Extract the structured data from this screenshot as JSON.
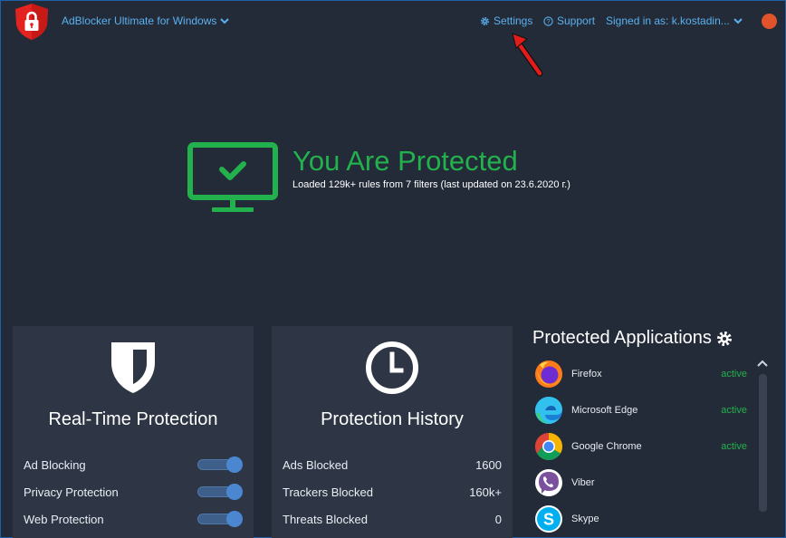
{
  "header": {
    "app_title": "AdBlocker Ultimate for Windows",
    "settings": "Settings",
    "support": "Support",
    "signed_in": "Signed in as: k.kostadin..."
  },
  "hero": {
    "title": "You Are Protected",
    "subtitle": "Loaded 129k+ rules from 7 filters (last updated on 23.6.2020 г.)"
  },
  "realtime": {
    "title": "Real-Time Protection",
    "items": [
      {
        "label": "Ad Blocking",
        "enabled": true
      },
      {
        "label": "Privacy Protection",
        "enabled": true
      },
      {
        "label": "Web Protection",
        "enabled": true
      }
    ]
  },
  "history": {
    "title": "Protection History",
    "items": [
      {
        "label": "Ads Blocked",
        "value": "1600"
      },
      {
        "label": "Trackers Blocked",
        "value": "160k+"
      },
      {
        "label": "Threats Blocked",
        "value": "0"
      }
    ]
  },
  "apps": {
    "title": "Protected Applications",
    "items": [
      {
        "name": "Firefox",
        "status": "active",
        "icon": "firefox-icon"
      },
      {
        "name": "Microsoft Edge",
        "status": "active",
        "icon": "edge-icon"
      },
      {
        "name": "Google Chrome",
        "status": "active",
        "icon": "chrome-icon"
      },
      {
        "name": "Viber",
        "status": "",
        "icon": "viber-icon"
      },
      {
        "name": "Skype",
        "status": "",
        "icon": "skype-icon"
      }
    ]
  },
  "colors": {
    "background": "#242b38",
    "card": "#2e3646",
    "accent_blue": "#5ab1f0",
    "protected_green": "#22b14c",
    "close_orange": "#e0532b"
  }
}
